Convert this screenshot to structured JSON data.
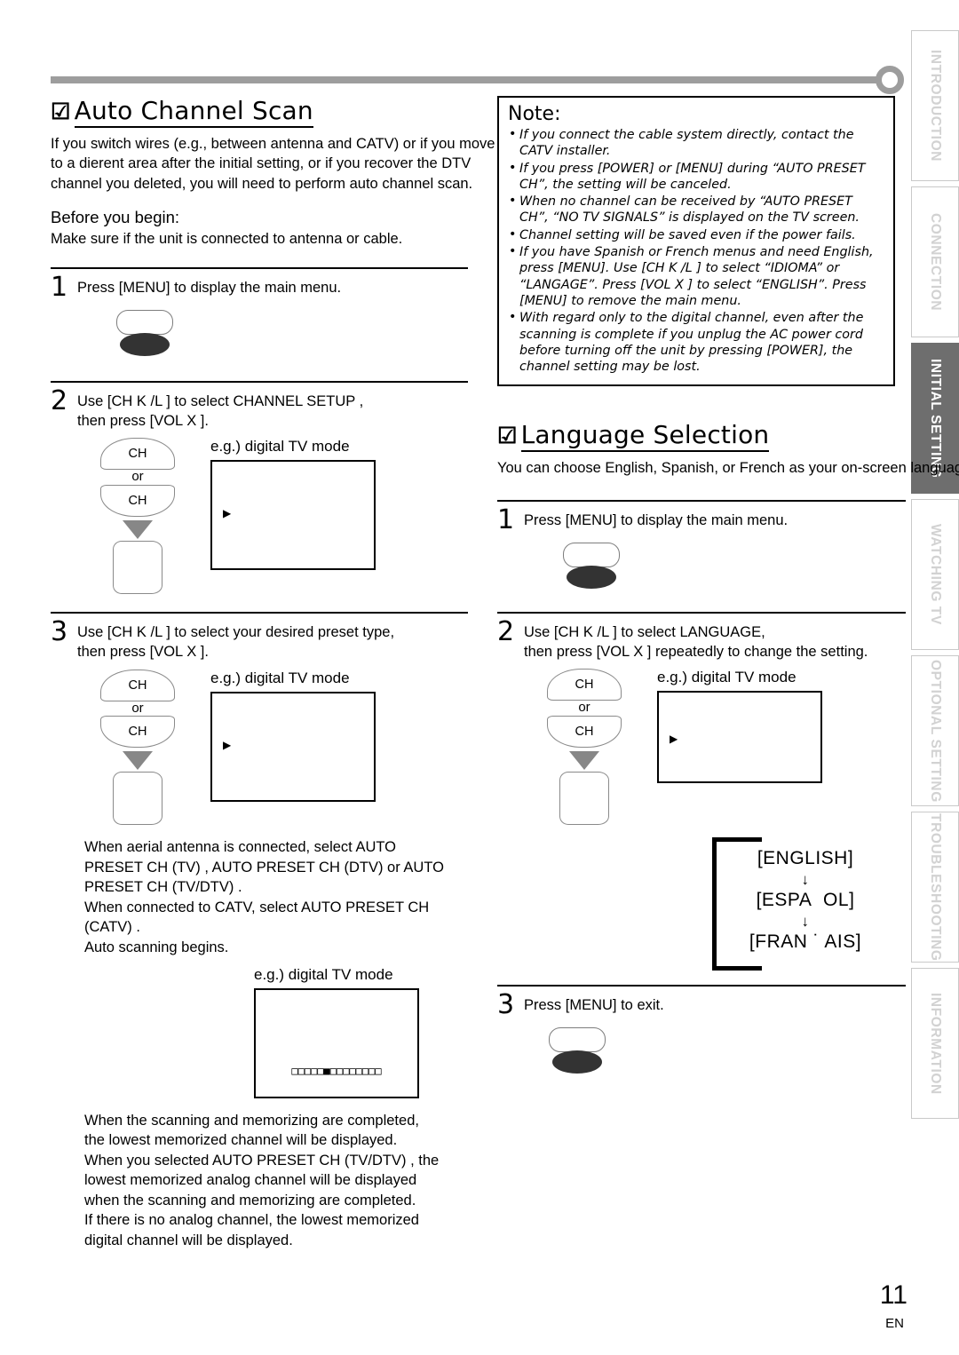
{
  "page": {
    "number": "11",
    "lang_code": "EN"
  },
  "rail": {
    "tabs": [
      {
        "label": "INTRODUCTION",
        "active": false
      },
      {
        "label": "CONNECTION",
        "active": false
      },
      {
        "label": "INITIAL  SETTING",
        "active": true
      },
      {
        "label": "WATCHING  TV",
        "active": false
      },
      {
        "label": "OPTIONAL  SETTING",
        "active": false
      },
      {
        "label": "TROUBLESHOOTING",
        "active": false
      },
      {
        "label": "INFORMATION",
        "active": false
      }
    ]
  },
  "auto_scan": {
    "check_glyph": "☑",
    "title": "Auto Channel Scan",
    "intro": "If you switch wires (e.g., between antenna and CATV) or if you move to a dierent area after the initial setting, or if you recover the DTV channel you deleted, you will need to perform auto channel scan.",
    "before_heading": "Before you begin:",
    "before_text": "Make sure if the unit is connected to antenna or cable.",
    "steps": [
      {
        "num": "1",
        "text": "Press [MENU] to display the main menu."
      },
      {
        "num": "2",
        "line1": "Use [CH K /L ] to select  CHANNEL SETUP ,",
        "line2": "then press [VOL X ].",
        "tv_caption": "e.g.) digital TV mode"
      },
      {
        "num": "3",
        "line1": "Use [CH K /L ] to select your desired preset type,",
        "line2": "then press [VOL X ].",
        "tv_caption": "e.g.) digital TV mode"
      }
    ],
    "key_ch_up_label": "CH",
    "key_or_label": "or",
    "key_ch_dn_label": "CH",
    "after_step3": [
      "When aerial antenna is connected, select  AUTO",
      "PRESET CH (TV) ,  AUTO PRESET CH (DTV)  or  AUTO",
      "PRESET CH (TV/DTV) .",
      "When connected to CATV, select  AUTO PRESET CH",
      "(CATV) .",
      "Auto scanning begins."
    ],
    "scan_tv_caption": "e.g.) digital TV mode",
    "scan_progress": "□□□□□■□□□□□□□□",
    "closing": [
      "When the scanning and memorizing are completed,",
      "the lowest memorized channel will be displayed.",
      "When you selected  AUTO PRESET CH (TV/DTV) , the",
      "lowest memorized analog channel will be displayed",
      "when the scanning and memorizing are completed.",
      "If there is no analog channel, the lowest memorized",
      "digital channel will be displayed."
    ]
  },
  "note": {
    "title": "Note:",
    "items": [
      "If you connect the cable system directly, contact the CATV installer.",
      "If you press [POWER] or [MENU] during “AUTO PRESET CH”, the setting will be canceled.",
      "When no channel can be received by “AUTO PRESET CH”, “NO TV SIGNALS” is displayed on the TV screen.",
      "Channel setting will be saved even if the power fails.",
      "If you have Spanish or French menus and need English, press [MENU]. Use [CH K /L ] to select “IDIOMA” or “LANGAGE”. Press [VOL X ] to select “ENGLISH”. Press [MENU] to remove the main menu.",
      "With regard only to the digital channel, even after the scanning is complete if you unplug the AC power cord before turning off the unit by pressing [POWER], the channel setting may be lost."
    ]
  },
  "language": {
    "check_glyph": "☑",
    "title": "Language Selection",
    "intro": "You can choose English, Spanish, or French as your on-screen language.",
    "steps": [
      {
        "num": "1",
        "text": "Press [MENU] to display the main menu."
      },
      {
        "num": "2",
        "line1": "Use [CH K /L ] to select  LANGUAGE,",
        "line2": "then press [VOL X ] repeatedly to change the setting.",
        "tv_caption": "e.g.) digital TV mode"
      },
      {
        "num": "3",
        "text": "Press [MENU] to exit."
      }
    ],
    "key_ch_up_label": "CH",
    "key_or_label": "or",
    "key_ch_dn_label": "CH",
    "cycle": {
      "arrow": "↓",
      "options": [
        "[ENGLISH]",
        "[ESPA  OL]",
        "[FRAN ˙ AIS]"
      ]
    }
  }
}
